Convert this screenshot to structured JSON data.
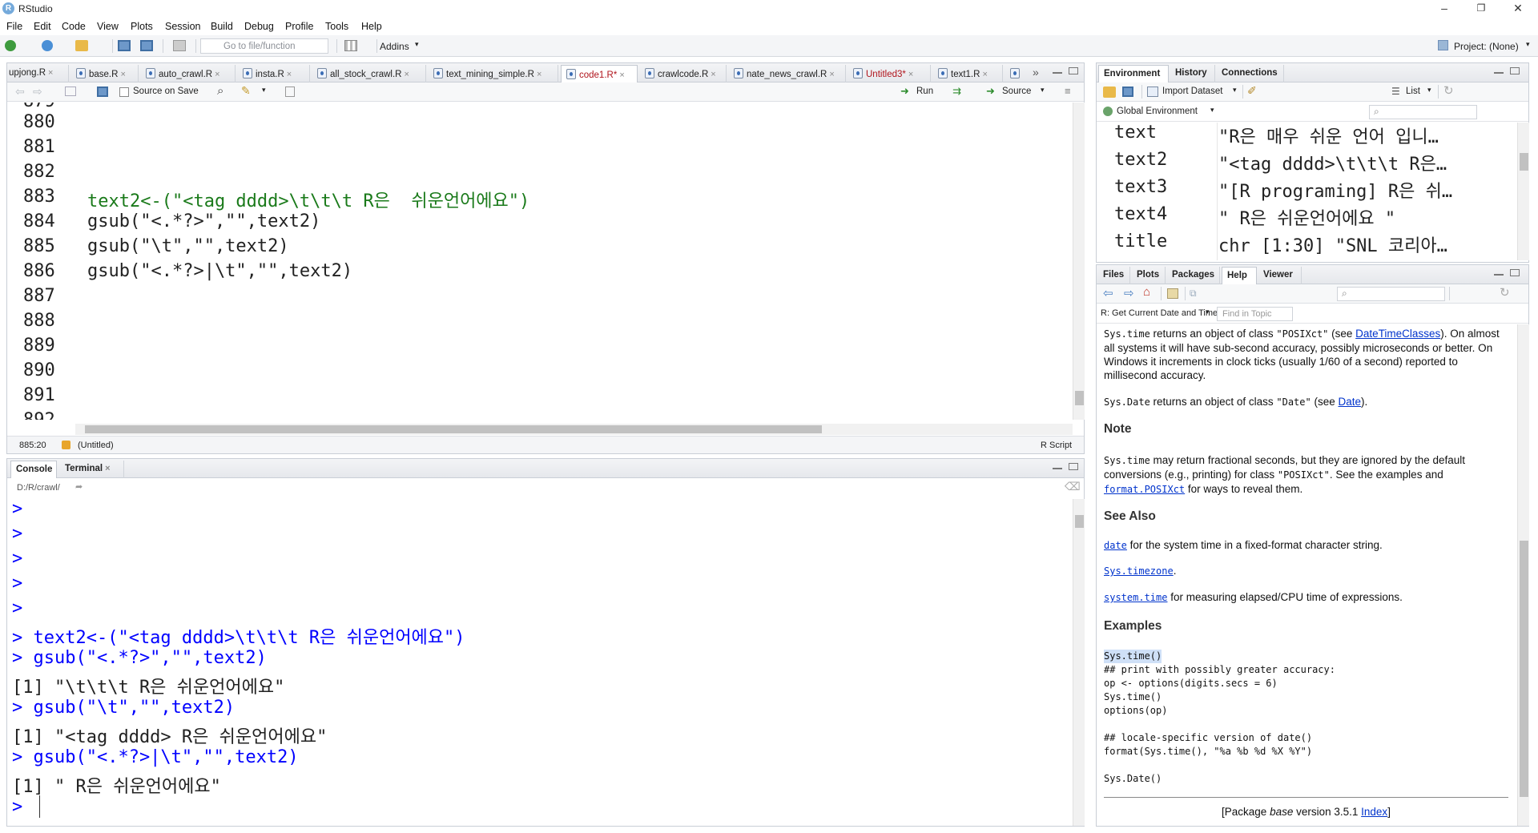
{
  "app": {
    "title": "RStudio",
    "logo_letter": "R"
  },
  "window_controls": {
    "minimize": "–",
    "maximize": "❐",
    "close": "✕"
  },
  "menu": [
    "File",
    "Edit",
    "Code",
    "View",
    "Plots",
    "Session",
    "Build",
    "Debug",
    "Profile",
    "Tools",
    "Help"
  ],
  "toolbar": {
    "goto_placeholder": "Go to file/function",
    "addins": "Addins",
    "project": "Project: (None)"
  },
  "editor": {
    "tabs": [
      {
        "label": "upjong.R",
        "modified": false
      },
      {
        "label": "base.R",
        "modified": false
      },
      {
        "label": "auto_crawl.R",
        "modified": false
      },
      {
        "label": "insta.R",
        "modified": false
      },
      {
        "label": "all_stock_crawl.R",
        "modified": false
      },
      {
        "label": "text_mining_simple.R",
        "modified": false
      },
      {
        "label": "code1.R*",
        "modified": true,
        "active": true
      },
      {
        "label": "crawlcode.R",
        "modified": false
      },
      {
        "label": "nate_news_crawl.R",
        "modified": false
      },
      {
        "label": "Untitled3*",
        "modified": true
      },
      {
        "label": "text1.R",
        "modified": false
      }
    ],
    "source_on_save": "Source on Save",
    "run": "Run",
    "source": "Source",
    "partial_line": "879",
    "lines": [
      {
        "num": "880",
        "code": ""
      },
      {
        "num": "881",
        "code": ""
      },
      {
        "num": "882",
        "code": ""
      },
      {
        "num": "883",
        "code": "text2<-(\"<tag dddd>\\t\\t\\t R은  쉬운언어에요\")"
      },
      {
        "num": "884",
        "code": "gsub(\"<.*?>\",\"\",text2)"
      },
      {
        "num": "885",
        "code": "gsub(\"\\t\",\"\",text2)"
      },
      {
        "num": "886",
        "code": "gsub(\"<.*?>|\\t\",\"\",text2)"
      },
      {
        "num": "887",
        "code": ""
      },
      {
        "num": "888",
        "code": ""
      },
      {
        "num": "889",
        "code": ""
      },
      {
        "num": "890",
        "code": ""
      },
      {
        "num": "891",
        "code": ""
      },
      {
        "num": "892",
        "code": ""
      }
    ],
    "status_pos": "885:20",
    "status_scope": "(Untitled)",
    "status_type": "R Script"
  },
  "console": {
    "tabs": [
      "Console",
      "Terminal"
    ],
    "path": "D:/R/crawl/",
    "lines": [
      {
        "kind": "prompt",
        "text": ">"
      },
      {
        "kind": "prompt",
        "text": ">"
      },
      {
        "kind": "prompt",
        "text": ">"
      },
      {
        "kind": "prompt",
        "text": ">"
      },
      {
        "kind": "prompt",
        "text": ">"
      },
      {
        "kind": "cmd",
        "text": "> text2<-(\"<tag dddd>\\t\\t\\t R은 쉬운언어에요\")"
      },
      {
        "kind": "cmd",
        "text": "> gsub(\"<.*?>\",\"\",text2)"
      },
      {
        "kind": "out",
        "text": "[1] \"\\t\\t\\t R은 쉬운언어에요\""
      },
      {
        "kind": "cmd",
        "text": "> gsub(\"\\t\",\"\",text2)"
      },
      {
        "kind": "out",
        "text": "[1] \"<tag dddd> R은 쉬운언어에요\""
      },
      {
        "kind": "cmd",
        "text": "> gsub(\"<.*?>|\\t\",\"\",text2)"
      },
      {
        "kind": "out",
        "text": "[1] \" R은 쉬운언어에요\""
      },
      {
        "kind": "prompt",
        "text": ">"
      }
    ]
  },
  "environment": {
    "tabs": [
      "Environment",
      "History",
      "Connections"
    ],
    "import_dataset": "Import Dataset",
    "list_view": "List",
    "scope": "Global Environment",
    "rows": [
      {
        "name": "text",
        "value": "\"R은 매우 쉬운 언어 입니…"
      },
      {
        "name": "text2",
        "value": "\"<tag dddd>\\t\\t\\t R은…"
      },
      {
        "name": "text3",
        "value": "\"[R programing] R은 쉬…"
      },
      {
        "name": "text4",
        "value": "\" R은 쉬운언어에요 \""
      },
      {
        "name": "title",
        "value": "chr [1:30] \"SNL 코리아…"
      }
    ]
  },
  "help": {
    "tabs": [
      "Files",
      "Plots",
      "Packages",
      "Help",
      "Viewer"
    ],
    "topic": "R: Get Current Date and Time",
    "find_placeholder": "Find in Topic",
    "p1_code": "Sys.time",
    "p1_a": " returns an object of class ",
    "p1_cls": "\"POSIXct\"",
    "p1_b": " (see ",
    "p1_link": "DateTimeClasses",
    "p1_c": "). On almost all systems it will have sub-second accuracy, possibly microseconds or better. On Windows it increments in clock ticks (usually 1/60 of a second) reported to millisecond accuracy.",
    "p2_code": "Sys.Date",
    "p2_a": " returns an object of class ",
    "p2_cls": "\"Date\"",
    "p2_b": " (see ",
    "p2_link": "Date",
    "p2_c": ").",
    "note_h": "Note",
    "note_code": "Sys.time",
    "note_a": " may return fractional seconds, but they are ignored by the default conversions (e.g., printing) for class ",
    "note_cls": "\"POSIXct\"",
    "note_b": ". See the examples and ",
    "note_link": "format.POSIXct",
    "note_c": " for ways to reveal them.",
    "seealso_h": "See Also",
    "sa1_link": "date",
    "sa1_text": " for the system time in a fixed-format character string.",
    "sa2_link": "Sys.timezone",
    "sa2_text": ".",
    "sa3_link": "system.time",
    "sa3_text": " for measuring elapsed/CPU time of expressions.",
    "examples_h": "Examples",
    "ex_lines": [
      "Sys.time()",
      "## print with possibly greater accuracy:",
      "op <- options(digits.secs = 6)",
      "Sys.time()",
      "options(op)",
      "",
      "## locale-specific version of date()",
      "format(Sys.time(), \"%a %b %d %X %Y\")",
      "",
      "Sys.Date()"
    ],
    "footer_a": "[Package ",
    "footer_pkg": "base",
    "footer_b": " version 3.5.1 ",
    "footer_link": "Index",
    "footer_c": "]"
  },
  "colors": {
    "accent": "#75aadb",
    "code_string": "#1a7a1a",
    "console_cmd": "#0000ff",
    "link": "#0033cc"
  }
}
